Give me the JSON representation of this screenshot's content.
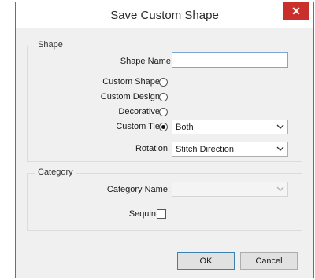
{
  "dialog": {
    "title": "Save Custom Shape",
    "close_icon": "close-icon"
  },
  "shape_group": {
    "label": "Shape",
    "shape_name_label": "Shape Name:",
    "shape_name_value": "",
    "options": [
      {
        "label": "Custom Shape",
        "checked": false
      },
      {
        "label": "Custom Design",
        "checked": false
      },
      {
        "label": "Decorative",
        "checked": false
      },
      {
        "label": "Custom Tie",
        "checked": true
      }
    ],
    "tie_select_value": "Both",
    "rotation_label": "Rotation:",
    "rotation_value": "Stitch Direction"
  },
  "category_group": {
    "label": "Category",
    "category_name_label": "Category Name:",
    "category_name_value": "",
    "sequin_label": "Sequin",
    "sequin_checked": false
  },
  "buttons": {
    "ok_label": "OK",
    "cancel_label": "Cancel"
  }
}
